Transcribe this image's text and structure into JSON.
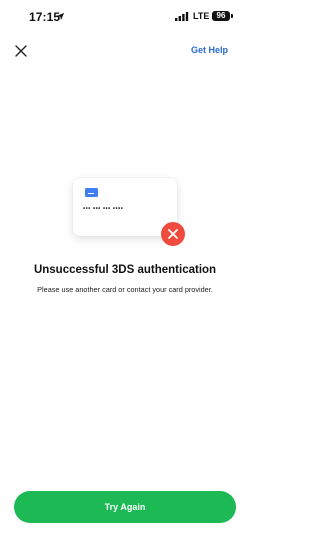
{
  "status_bar": {
    "time": "17:15",
    "network": "LTE",
    "battery": "96",
    "location_icon": "location-arrow-icon",
    "signal_icon": "signal-bars-icon"
  },
  "header": {
    "close_icon": "close-icon",
    "help_label": "Get Help"
  },
  "illustration": {
    "card_number": "••• ••• ••• ••••",
    "chip_icon": "card-chip-icon",
    "error_icon": "error-x-icon"
  },
  "message": {
    "title": "Unsuccessful 3DS authentication",
    "subtitle": "Please use another card or contact your card provider."
  },
  "actions": {
    "primary_label": "Try Again"
  },
  "colors": {
    "accent": "#1db954",
    "link": "#2a6ad3",
    "error": "#ef4b3e",
    "chip": "#3d7ff0"
  }
}
